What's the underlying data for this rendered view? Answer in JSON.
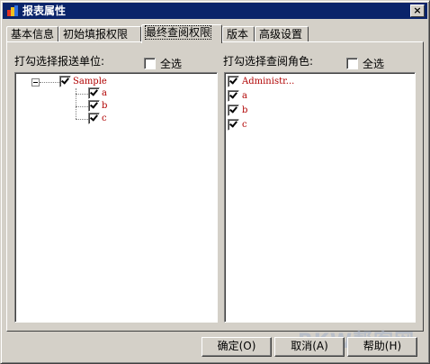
{
  "window": {
    "title": "报表属性",
    "close_glyph": "×"
  },
  "tabs": [
    {
      "label": "基本信息"
    },
    {
      "label": "初始填报权限"
    },
    {
      "label": "最终查阅权限",
      "active": true
    },
    {
      "label": "版本"
    },
    {
      "label": "高级设置"
    }
  ],
  "left": {
    "label": "打勾选择报送单位:",
    "select_all": "全选",
    "select_all_checked": false,
    "tree": {
      "root": {
        "label": "Sample",
        "checked": true
      },
      "children": [
        {
          "label": "a",
          "checked": true
        },
        {
          "label": "b",
          "checked": true
        },
        {
          "label": "c",
          "checked": true
        }
      ]
    }
  },
  "right": {
    "label": "打勾选择查阅角色:",
    "select_all": "全选",
    "select_all_checked": false,
    "items": [
      {
        "label": "Administr...",
        "checked": true
      },
      {
        "label": "a",
        "checked": true
      },
      {
        "label": "b",
        "checked": true
      },
      {
        "label": "c",
        "checked": true
      }
    ]
  },
  "buttons": {
    "ok": "确定(O)",
    "cancel": "取消(A)",
    "help": "帮助(H)"
  },
  "watermark": "BKW帮客网",
  "colors": {
    "titlebar": "#0a246a",
    "item_text": "#b00000",
    "face": "#d4d0c8"
  }
}
